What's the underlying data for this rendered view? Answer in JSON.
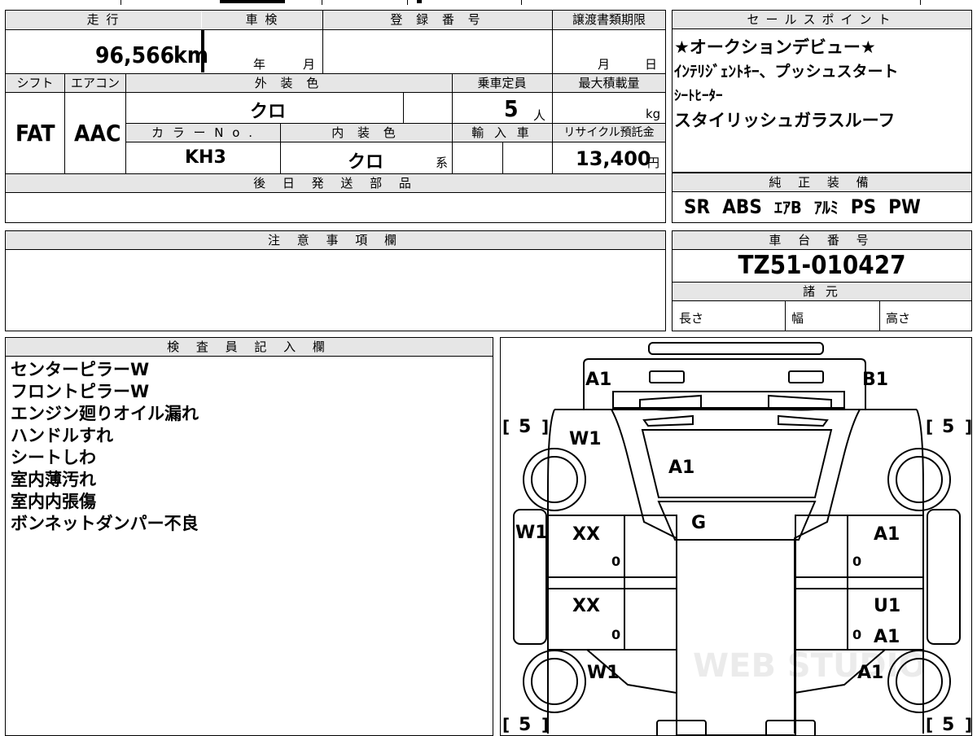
{
  "vehicle": {
    "mileage_label": "走 行",
    "mileage": "96,566",
    "mileage_unit": "km",
    "shaken_label": "車 検",
    "shaken_year": "年",
    "shaken_month": "月",
    "registration_label": "登 録 番 号",
    "transfer_deadline_label": "譲渡書類期限",
    "transfer_month": "月",
    "transfer_day": "日",
    "shift_label": "シフト",
    "shift": "FAT",
    "aircon_label": "エアコン",
    "aircon": "AAC",
    "exterior_label": "外 装 色",
    "exterior_color": "クロ",
    "capacity_label": "乗車定員",
    "capacity": "5",
    "capacity_unit": "人",
    "max_load_label": "最大積載量",
    "max_load_unit": "kg",
    "color_no_label": "カ ラ ー N o .",
    "color_no": "KH3",
    "interior_label": "内 装 色",
    "interior_color": "クロ",
    "interior_suffix": "系",
    "import_label": "輸 入 車",
    "recycle_label": "リサイクル預託金",
    "recycle_fee": "13,400",
    "recycle_unit": "円",
    "later_parts_label": "後 日 発 送 部 品"
  },
  "sales": {
    "header": "セールスポイント",
    "points": [
      "★オークションデビュー★",
      "ｲﾝﾃﾘｼﾞｪﾝﾄｷｰ、プッシュスタート",
      "ｼｰﾄﾋｰﾀｰ",
      "スタイリッシュガラスルーフ"
    ]
  },
  "equipment": {
    "header": "純 正 装 備",
    "items": [
      "SR",
      "ABS",
      "ｴｱB",
      "ｱﾙﾐ",
      "PS",
      "PW"
    ]
  },
  "caution": {
    "header": "注 意 事 項 欄"
  },
  "chassis": {
    "header": "車 台 番 号",
    "number": "TZ51-010427",
    "specs_header": "諸 元",
    "length": "長さ",
    "width": "幅",
    "height": "高さ"
  },
  "inspector": {
    "header": "検 査 員 記 入 欄",
    "notes": [
      "センターピラーW",
      "フロントピラーW",
      "エンジン廻りオイル漏れ",
      "ハンドルすれ",
      "シートしわ",
      "室内薄汚れ",
      "室内内張傷",
      "ボンネットダンパー不良"
    ]
  },
  "diagram": {
    "codes": {
      "front_left": "A1",
      "front_right": "B1",
      "fender_fl": "W1",
      "hood": "A1",
      "roof": "G",
      "pillar_left": "W1",
      "door_fl": "XX",
      "door_rl": "XX",
      "door_fr": "A1",
      "door_rr_1": "U1",
      "door_rr_2": "A1",
      "rear_left": "W1",
      "rear_right": "A1",
      "tire_fl": "5",
      "tire_fr": "5",
      "tire_rl": "5",
      "tire_rr": "5",
      "door_fl_num": "0",
      "door_rl_num": "0",
      "door_fr_num": "0",
      "door_rr_num": "0"
    },
    "watermark": "WEB STUDIO"
  }
}
